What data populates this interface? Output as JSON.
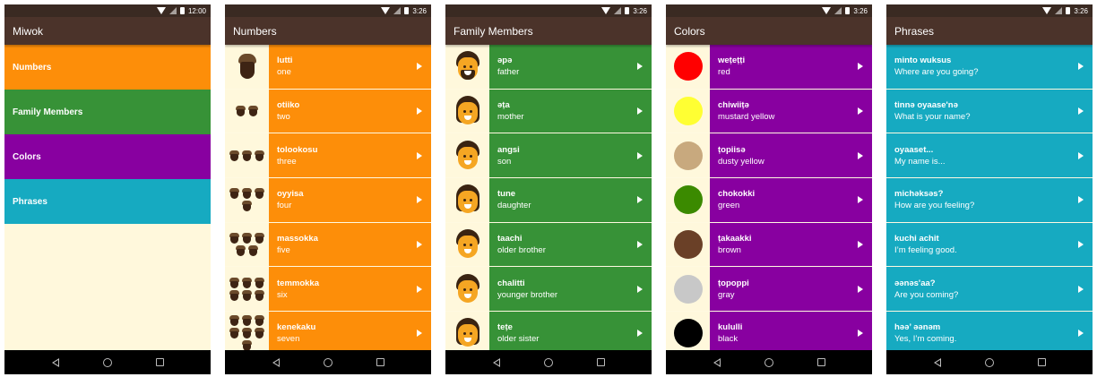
{
  "status": {
    "time_main": "12:00",
    "time_list": "3:26"
  },
  "main": {
    "title": "Miwok",
    "categories": [
      {
        "label": "Numbers",
        "color": "#fd8e09"
      },
      {
        "label": "Family Members",
        "color": "#379237"
      },
      {
        "label": "Colors",
        "color": "#8800a0"
      },
      {
        "label": "Phrases",
        "color": "#16aac1"
      }
    ]
  },
  "numbers": {
    "title": "Numbers",
    "color": "#fd8e09",
    "rows": [
      {
        "miwok": "lutti",
        "english": "one",
        "count": 1
      },
      {
        "miwok": "otiiko",
        "english": "two",
        "count": 2
      },
      {
        "miwok": "tolookosu",
        "english": "three",
        "count": 3
      },
      {
        "miwok": "oyyisa",
        "english": "four",
        "count": 4
      },
      {
        "miwok": "massokka",
        "english": "five",
        "count": 5
      },
      {
        "miwok": "temmokka",
        "english": "six",
        "count": 6
      },
      {
        "miwok": "kenekaku",
        "english": "seven",
        "count": 7
      }
    ]
  },
  "family": {
    "title": "Family Members",
    "color": "#379237",
    "rows": [
      {
        "miwok": "əpə",
        "english": "father",
        "icon": "father-icon"
      },
      {
        "miwok": "əṭa",
        "english": "mother",
        "icon": "mother-icon"
      },
      {
        "miwok": "angsi",
        "english": "son",
        "icon": "son-icon"
      },
      {
        "miwok": "tune",
        "english": "daughter",
        "icon": "daughter-icon"
      },
      {
        "miwok": "taachi",
        "english": "older brother",
        "icon": "older-brother-icon"
      },
      {
        "miwok": "chalitti",
        "english": "younger brother",
        "icon": "younger-brother-icon"
      },
      {
        "miwok": "teṭe",
        "english": "older sister",
        "icon": "older-sister-icon"
      }
    ]
  },
  "colors": {
    "title": "Colors",
    "color": "#8800a0",
    "rows": [
      {
        "miwok": "weṭeṭṭi",
        "english": "red",
        "swatch": "#ff0000"
      },
      {
        "miwok": "chiwiiṭə",
        "english": "mustard yellow",
        "swatch": "#ffff33"
      },
      {
        "miwok": "ṭopiisə",
        "english": "dusty yellow",
        "swatch": "#c8a97e"
      },
      {
        "miwok": "chokokki",
        "english": "green",
        "swatch": "#3b8a00"
      },
      {
        "miwok": "ṭakaakki",
        "english": "brown",
        "swatch": "#6a4027"
      },
      {
        "miwok": "ṭopoppi",
        "english": "gray",
        "swatch": "#c8c8c8"
      },
      {
        "miwok": "kululli",
        "english": "black",
        "swatch": "#000000"
      }
    ]
  },
  "phrases": {
    "title": "Phrases",
    "color": "#16aac1",
    "rows": [
      {
        "miwok": "minto wuksus",
        "english": "Where are you going?"
      },
      {
        "miwok": "tinnә oyaase'nә",
        "english": "What is your name?"
      },
      {
        "miwok": "oyaaset...",
        "english": "My name is..."
      },
      {
        "miwok": "michәksәs?",
        "english": "How are you feeling?"
      },
      {
        "miwok": "kuchi achit",
        "english": "I’m feeling good."
      },
      {
        "miwok": "әәnәs'aa?",
        "english": "Are you coming?"
      },
      {
        "miwok": "hәә’ әәnәm",
        "english": "Yes, I’m coming."
      }
    ]
  }
}
